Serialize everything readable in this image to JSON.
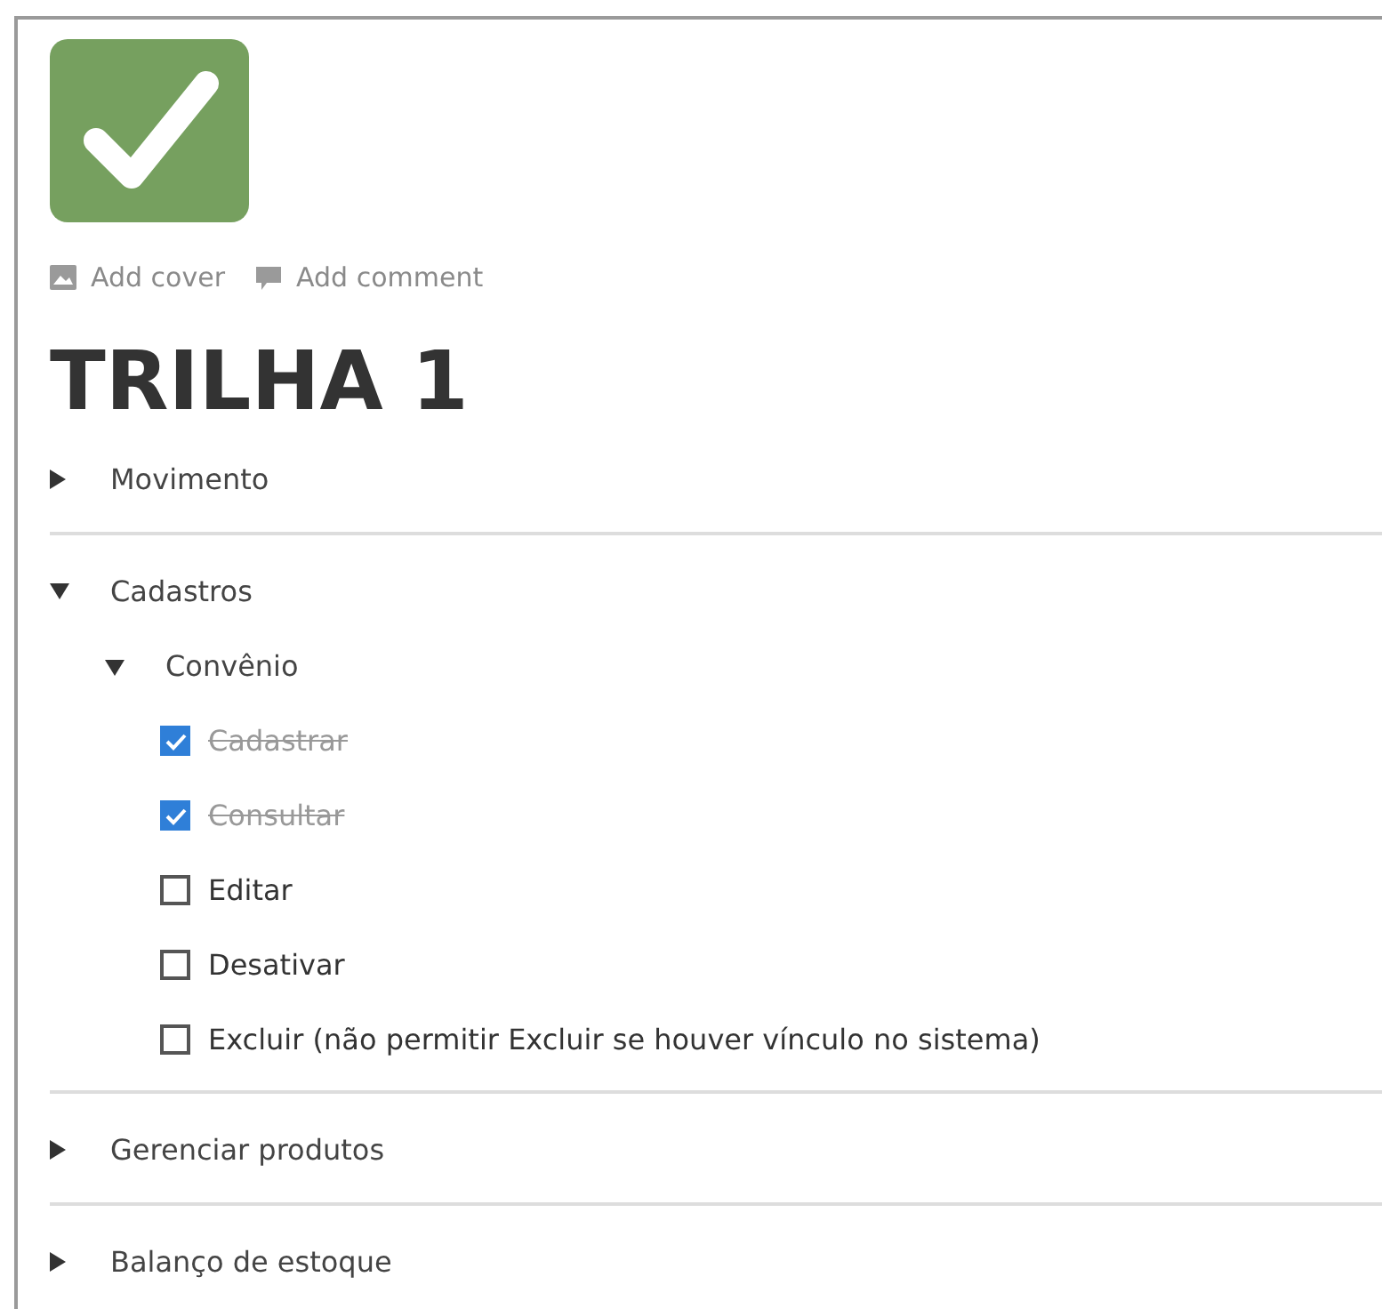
{
  "page": {
    "actions": [
      "Add cover",
      "Add comment"
    ],
    "title": "TRILHA 1"
  },
  "sections": [
    {
      "kind": "toggle",
      "label": "Movimento",
      "expanded": false
    },
    {
      "kind": "toggle",
      "label": "Cadastros",
      "expanded": true,
      "children": [
        {
          "kind": "toggle",
          "label": "Convênio",
          "expanded": true,
          "children": [
            {
              "kind": "todo",
              "label": "Cadastrar",
              "checked": true
            },
            {
              "kind": "todo",
              "label": "Consultar",
              "checked": true
            },
            {
              "kind": "todo",
              "label": "Editar",
              "checked": false
            },
            {
              "kind": "todo",
              "label": "Desativar",
              "checked": false
            },
            {
              "kind": "todo",
              "label": "Excluir (não permitir Excluir se houver vínculo no sistema)",
              "checked": false
            }
          ]
        }
      ]
    },
    {
      "kind": "toggle",
      "label": "Gerenciar produtos",
      "expanded": false
    },
    {
      "kind": "toggle",
      "label": "Balanço de estoque",
      "expanded": false
    }
  ]
}
